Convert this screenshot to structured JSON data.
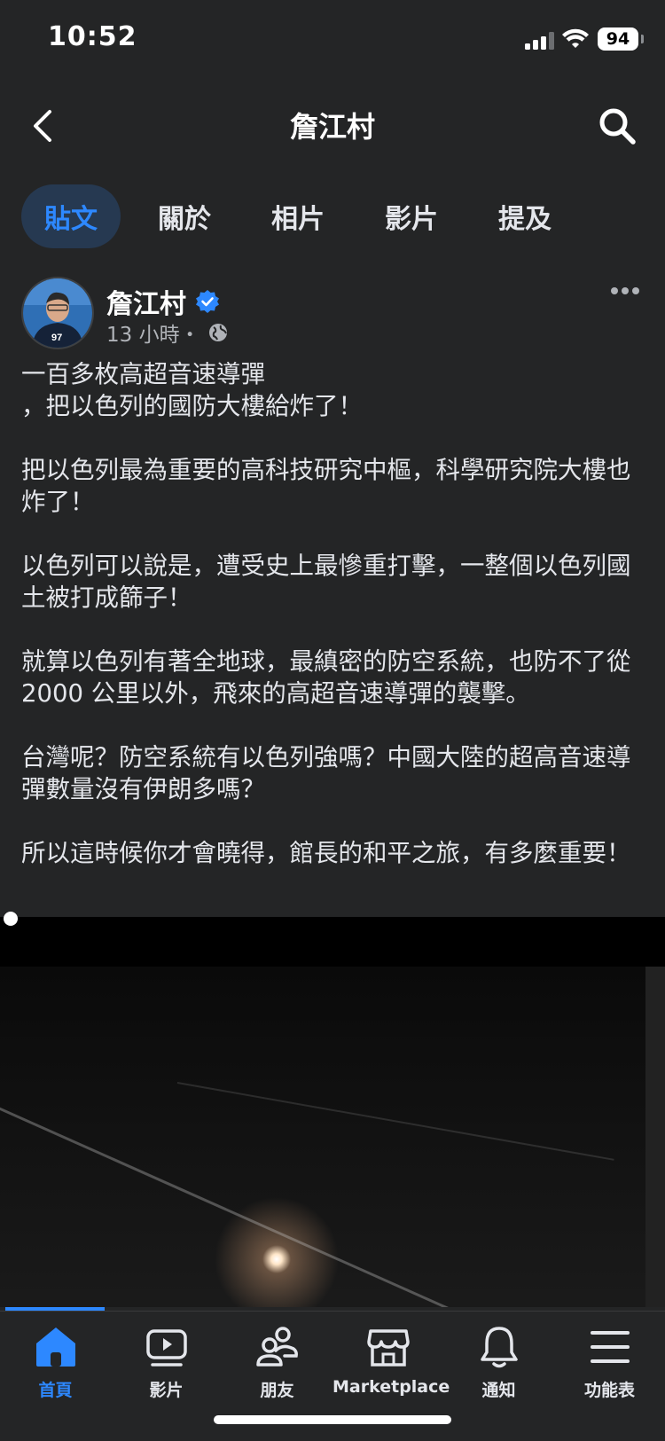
{
  "status_bar": {
    "time": "10:52",
    "battery": "94"
  },
  "header": {
    "title": "詹江村"
  },
  "tabs": [
    {
      "label": "貼文",
      "active": true
    },
    {
      "label": "關於",
      "active": false
    },
    {
      "label": "相片",
      "active": false
    },
    {
      "label": "影片",
      "active": false
    },
    {
      "label": "提及",
      "active": false
    }
  ],
  "post": {
    "author": "詹江村",
    "time": "13 小時・",
    "text": "一百多枚高超音速導彈\n，把以色列的國防大樓給炸了！\n\n把以色列最為重要的高科技研究中樞，科學研究院大樓也炸了！\n\n以色列可以說是，遭受史上最慘重打擊，一整個以色列國土被打成篩子！\n\n就算以色列有著全地球，最縝密的防空系統，也防不了從 2000 公里以外，飛來的高超音速導彈的襲擊。\n\n台灣呢？防空系統有以色列強嗎？中國大陸的超高音速導彈數量沒有伊朗多嗎？\n\n所以這時候你才會曉得，館長的和平之旅，有多麼重要！",
    "avatar_shirt_text": "97"
  },
  "bottom_nav": [
    {
      "label": "首頁",
      "icon": "home-icon",
      "active": true
    },
    {
      "label": "影片",
      "icon": "video-icon",
      "active": false
    },
    {
      "label": "朋友",
      "icon": "friends-icon",
      "active": false
    },
    {
      "label": "Marketplace",
      "icon": "marketplace-icon",
      "active": false
    },
    {
      "label": "通知",
      "icon": "bell-icon",
      "active": false
    },
    {
      "label": "功能表",
      "icon": "menu-icon",
      "active": false
    }
  ],
  "colors": {
    "accent": "#2d88ff",
    "background": "#242526",
    "active_tab_bg": "#263951"
  }
}
